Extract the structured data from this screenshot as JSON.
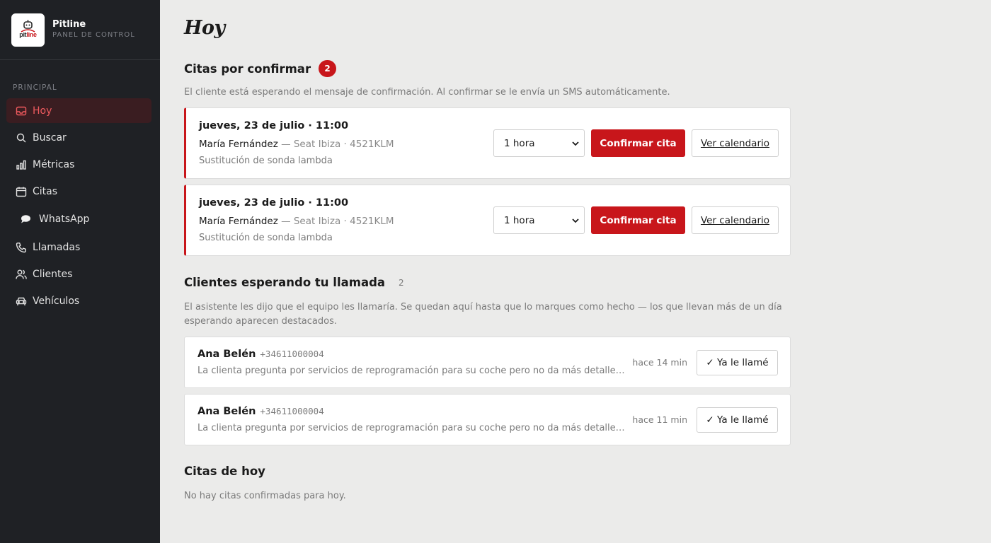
{
  "app": {
    "name": "Pitline",
    "subtitle": "PANEL DE CONTROL",
    "logo_text_part1": "pit",
    "logo_text_part2": "line"
  },
  "sidebar": {
    "section_label": "PRINCIPAL",
    "items": [
      {
        "label": "Hoy",
        "icon": "inbox-icon",
        "active": true
      },
      {
        "label": "Buscar",
        "icon": "search-icon"
      },
      {
        "label": "Métricas",
        "icon": "bar-chart-icon"
      },
      {
        "label": "Citas",
        "icon": "calendar-icon"
      },
      {
        "label": "WhatsApp",
        "icon": "chat-bubble-icon"
      },
      {
        "label": "Llamadas",
        "icon": "phone-icon"
      },
      {
        "label": "Clientes",
        "icon": "users-icon"
      },
      {
        "label": "Vehículos",
        "icon": "car-icon"
      }
    ]
  },
  "page": {
    "title": "Hoy"
  },
  "pending": {
    "title": "Citas por confirmar",
    "count": "2",
    "description": "El cliente está esperando el mensaje de confirmación. Al confirmar se le envía un SMS automáticamente.",
    "items": [
      {
        "date": "jueves, 23 de julio · 11:00",
        "client": "María Fernández",
        "vehicle": " — Seat Ibiza · 4521KLM",
        "service": "Sustitución de sonda lambda",
        "duration": "1 hora",
        "confirm_label": "Confirmar cita",
        "calendar_label": "Ver calendario"
      },
      {
        "date": "jueves, 23 de julio · 11:00",
        "client": "María Fernández",
        "vehicle": " — Seat Ibiza · 4521KLM",
        "service": "Sustitución de sonda lambda",
        "duration": "1 hora",
        "confirm_label": "Confirmar cita",
        "calendar_label": "Ver calendario"
      }
    ]
  },
  "calls": {
    "title": "Clientes esperando tu llamada",
    "count": "2",
    "description_line1": "El asistente les dijo que el equipo les llamaría. Se quedan aquí hasta que lo marques como hecho — los que llevan más de un día",
    "description_line2": "esperando aparecen destacados.",
    "items": [
      {
        "name": "Ana Belén",
        "phone": "+34611000004",
        "message": "La clienta pregunta por servicios de reprogramación para su coche pero no da más detalles. El equipo debe llamarla",
        "time": "hace 14 min",
        "button_label": "✓ Ya le llamé"
      },
      {
        "name": "Ana Belén",
        "phone": "+34611000004",
        "message": "La clienta pregunta por servicios de reprogramación para su coche pero no da más detalles. El equipo debe llamarla",
        "time": "hace 11 min",
        "button_label": "✓ Ya le llamé"
      }
    ]
  },
  "today": {
    "title": "Citas de hoy",
    "empty": "No hay citas confirmadas para hoy."
  },
  "colors": {
    "accent": "#c8161b",
    "sidebar_bg": "#1f2125",
    "main_bg": "#ebebea"
  }
}
